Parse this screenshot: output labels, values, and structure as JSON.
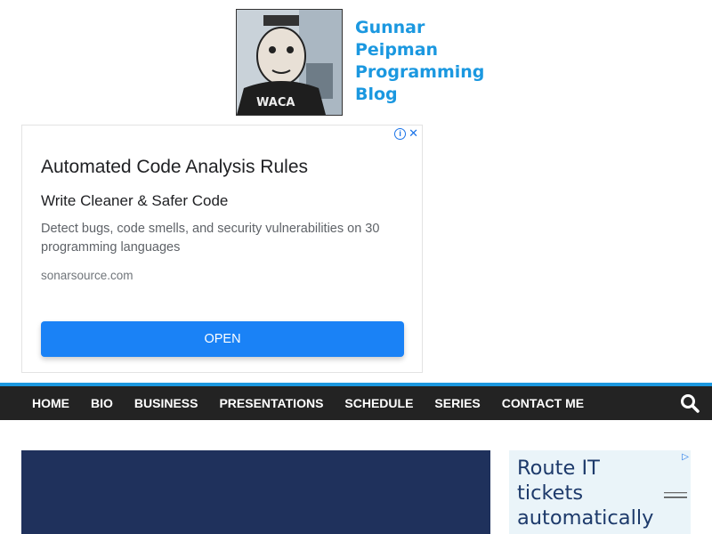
{
  "header": {
    "blog_title": "Gunnar\nPeipman\nProgramming\nBlog"
  },
  "ad": {
    "info_icon": "info-icon",
    "close_icon": "close-icon",
    "headline": "Automated Code Analysis Rules",
    "subheadline": "Write Cleaner & Safer Code",
    "description": "Detect bugs, code smells, and security vulnerabilities on 30 programming languages",
    "domain": "sonarsource.com",
    "button_label": "OPEN",
    "button_color": "#1a82f6"
  },
  "nav": {
    "items": [
      "HOME",
      "BIO",
      "BUSINESS",
      "PRESENTATIONS",
      "SCHEDULE",
      "SERIES",
      "CONTACT ME"
    ],
    "search_icon": "search-icon",
    "accent_color": "#1b98e0"
  },
  "sidebar_ad": {
    "text": "Route IT\ntickets\nautomatically"
  }
}
